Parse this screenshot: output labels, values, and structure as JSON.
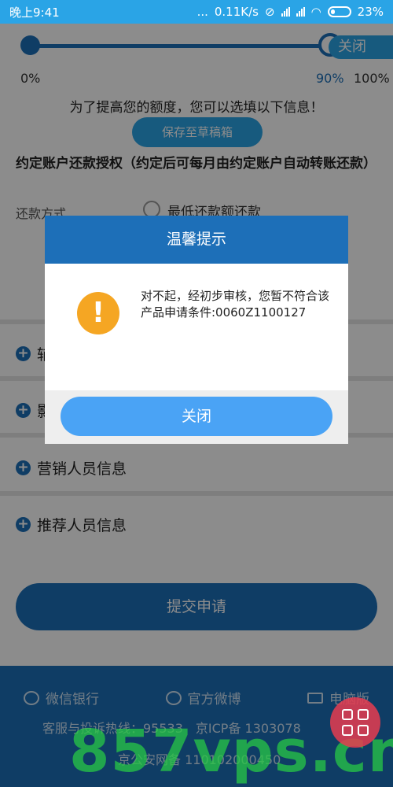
{
  "status_bar": {
    "time": "晚上9:41",
    "dots": "...",
    "speed": "0.11K/s",
    "battery": "23%"
  },
  "progress": {
    "close_label": "关闭",
    "start_label": "0%",
    "current_label": "90%",
    "end_label": "100%",
    "value": 0.9
  },
  "hint_text": "为了提高您的额度，您可以选填以下信息！",
  "draft_button": "保存至草稿箱",
  "repay_section": {
    "title": "约定账户还款授权（约定后可每月由约定账户自动转账还款）",
    "method_label": "还款方式",
    "option_label": "最低还款额还款"
  },
  "collapsible_rows": [
    {
      "label": "辅"
    },
    {
      "label": "影"
    },
    {
      "label": "营销人员信息"
    },
    {
      "label": "推荐人员信息"
    }
  ],
  "submit_button": "提交申请",
  "footer": {
    "links": [
      {
        "label": "微信银行",
        "icon": "wechat-icon"
      },
      {
        "label": "官方微博",
        "icon": "weibo-icon"
      },
      {
        "label": "电脑版",
        "icon": "monitor-icon"
      }
    ],
    "line1": "客服与投诉热线：95533　京ICP备 1303078",
    "line2": "京公安网备 110102000450"
  },
  "watermark": "857vps.cn",
  "dialog": {
    "title": "温馨提示",
    "message": "对不起，经初步审核，您暂不符合该产品申请条件:0060Z1100127",
    "close_label": "关闭"
  },
  "colors": {
    "primary": "#1d6fb8",
    "accent": "#2aa4e6",
    "warning": "#f5a623"
  }
}
